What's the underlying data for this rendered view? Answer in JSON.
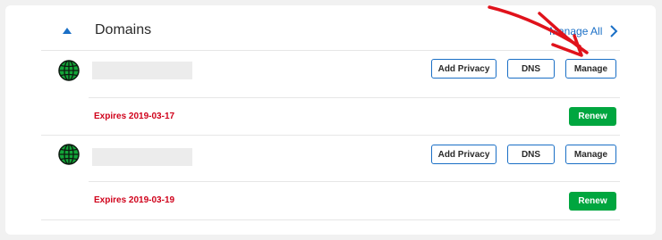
{
  "section": {
    "title": "Domains",
    "manage_all_label": "Manage All"
  },
  "domains": [
    {
      "buttons": {
        "privacy": "Add Privacy",
        "dns": "DNS",
        "manage": "Manage"
      },
      "expires": "Expires 2019-03-17",
      "renew": "Renew"
    },
    {
      "buttons": {
        "privacy": "Add Privacy",
        "dns": "DNS",
        "manage": "Manage"
      },
      "expires": "Expires 2019-03-19",
      "renew": "Renew"
    }
  ],
  "colors": {
    "accent": "#1a6fc6",
    "expires": "#d0021b",
    "renew": "#00a63f",
    "globe": "#13a538",
    "annotation_arrow": "#e0121b"
  },
  "icons": [
    "collapse-up-icon",
    "chevron-right-icon",
    "globe-icon",
    "annotation-arrow"
  ]
}
